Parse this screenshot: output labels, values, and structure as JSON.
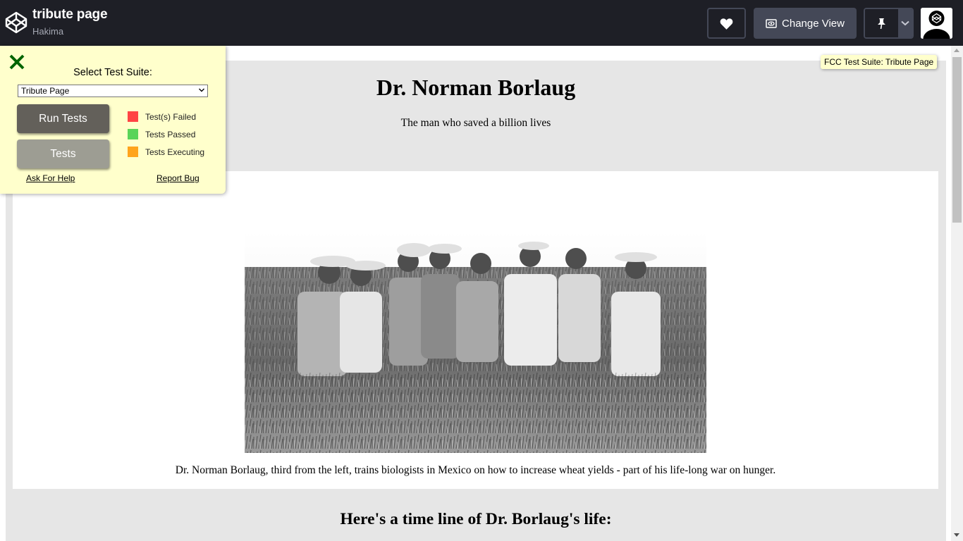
{
  "header": {
    "pen_title": "tribute page",
    "author": "Hakima",
    "change_view_label": "Change View",
    "icons": [
      "codepen-logo-icon",
      "heart-icon",
      "change-view-icon",
      "pin-icon",
      "chevron-down-icon",
      "avatar"
    ]
  },
  "tooltip": {
    "text": "FCC Test Suite: Tribute Page"
  },
  "tribute": {
    "title": "Dr. Norman Borlaug",
    "subtitle": "The man who saved a billion lives",
    "caption": "Dr. Norman Borlaug, third from the left, trains biologists in Mexico on how to increase wheat yields - part of his life-long war on hunger.",
    "timeline_heading": "Here's a time line of Dr. Borlaug's life:"
  },
  "test_panel": {
    "label": "Select Test Suite:",
    "selected_suite": "Tribute Page",
    "run_label": "Run Tests",
    "tests_label": "Tests",
    "legend": [
      {
        "label": "Test(s) Failed",
        "color": "#ff4444"
      },
      {
        "label": "Tests Passed",
        "color": "#59d459"
      },
      {
        "label": "Tests Executing",
        "color": "#ffa41c"
      }
    ],
    "help_link": "Ask For Help",
    "bug_link": "Report Bug"
  },
  "colors": {
    "header_bg": "#1e1f26",
    "header_button": "#444857",
    "panel_bg": "#ffffcc",
    "page_bg": "#e6e6e6",
    "close_icon": "#006400"
  }
}
